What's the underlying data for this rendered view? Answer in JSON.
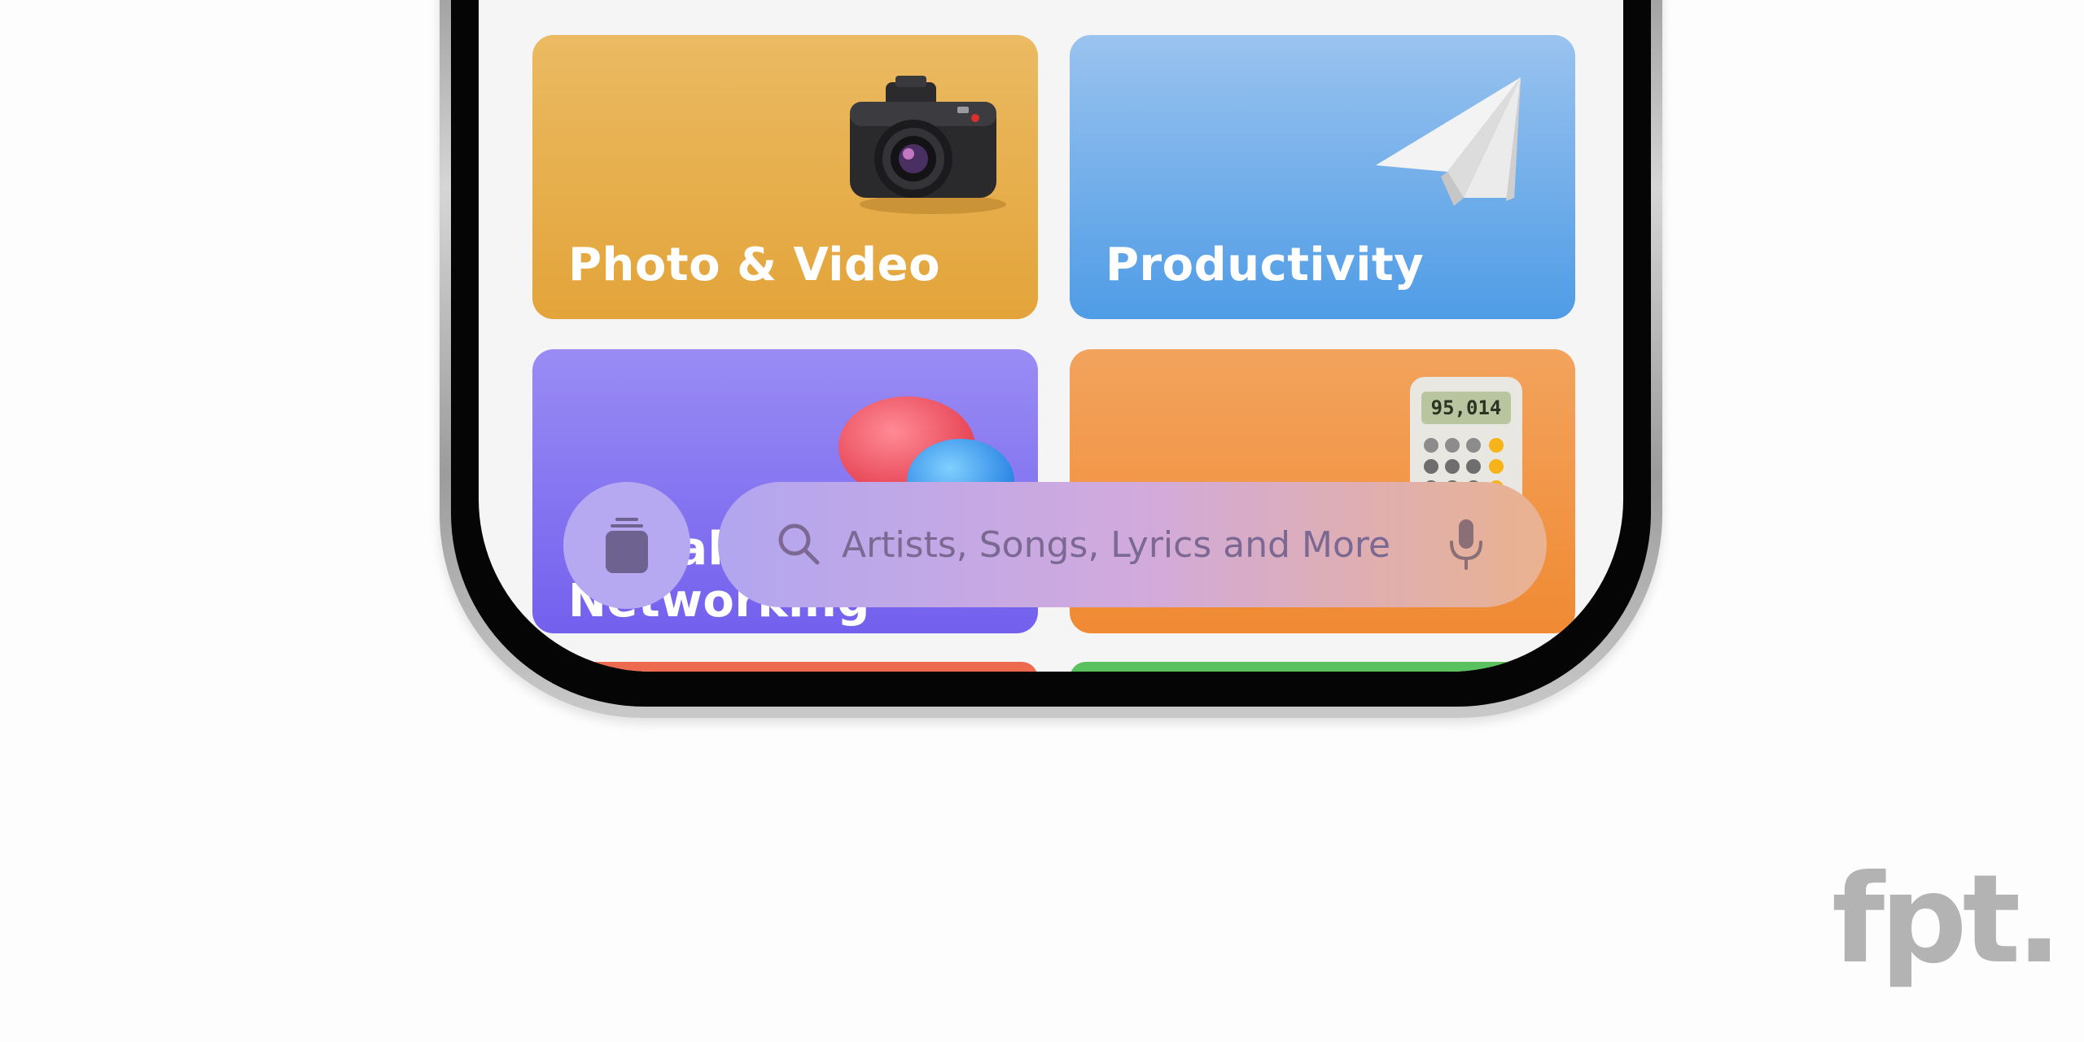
{
  "categories": {
    "photo_video": {
      "label": "Photo & Video",
      "icon": "camera-icon"
    },
    "productivity": {
      "label": "Productivity",
      "icon": "paper-plane-icon"
    },
    "social": {
      "label_line1": "Social",
      "label_line2": "Networking",
      "icon": "chat-bubbles-icon"
    },
    "utilities": {
      "icon": "calculator-icon",
      "calculator_display": "95,014"
    }
  },
  "search": {
    "placeholder": "Artists, Songs, Lyrics and More",
    "search_icon": "search-icon",
    "mic_icon": "microphone-icon"
  },
  "library_button": {
    "icon": "library-stack-icon"
  },
  "watermark": {
    "text": "fpt."
  },
  "colors": {
    "photo_video": "#e3a43a",
    "productivity": "#4f9ce6",
    "social": "#7360ee",
    "utilities": "#f08a33",
    "search_bar_start": "#b2a6ef",
    "search_bar_end": "#eab28f",
    "library_button": "#b7a9f1"
  }
}
